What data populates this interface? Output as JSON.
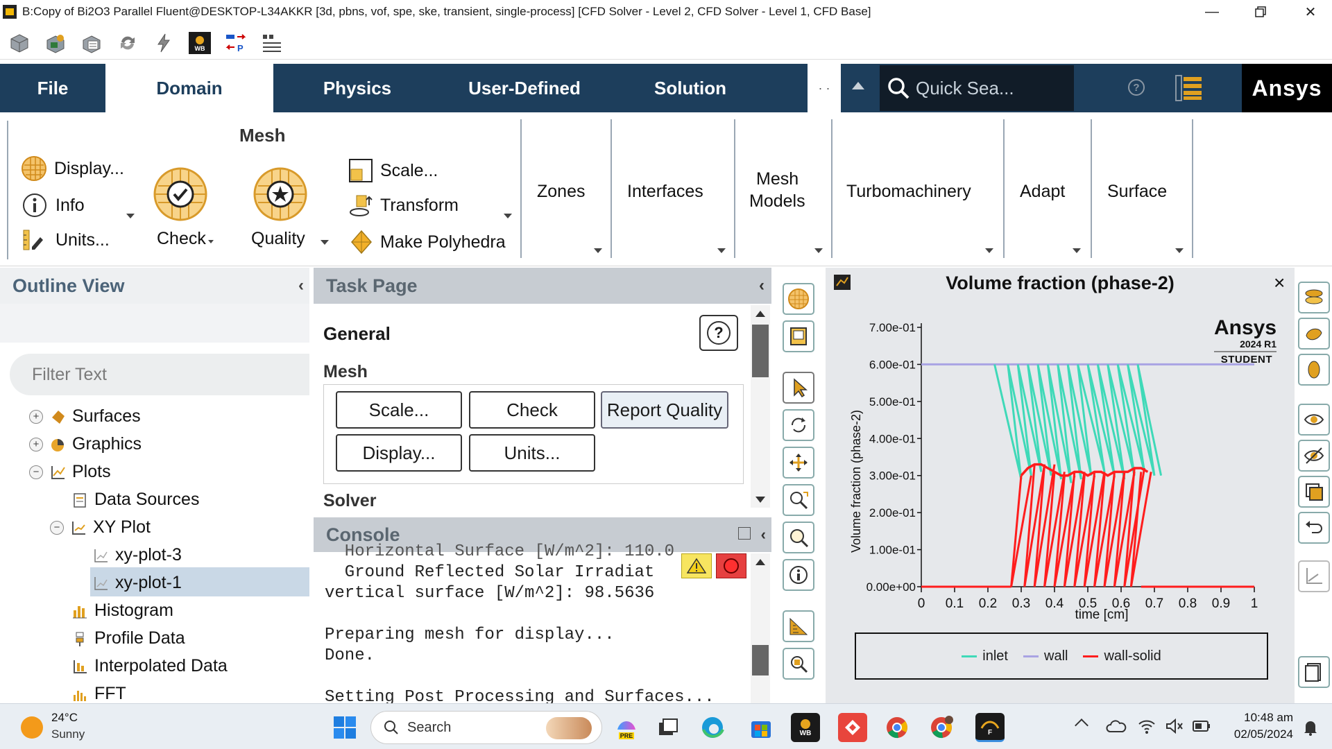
{
  "window": {
    "title": "B:Copy of Bi2O3 Parallel Fluent@DESKTOP-L34AKKR  [3d, pbns, vof, spe, ske, transient, single-process] [CFD Solver - Level 2, CFD Solver - Level 1, CFD Base]",
    "controls": [
      "minimize-icon",
      "restore-icon",
      "close-icon"
    ]
  },
  "quick_toolbar": {
    "icons": [
      "open-case-icon",
      "save-case-icon",
      "data-file-icon",
      "refresh-icon",
      "lightning-icon",
      "workbench-icon",
      "parameters-icon",
      "menu-list-icon"
    ],
    "wb_label": "WB",
    "p_label": "P"
  },
  "tabs": {
    "file": "File",
    "domain": "Domain",
    "physics": "Physics",
    "user_defined": "User-Defined",
    "solution": "Solution",
    "overflow": "· ·",
    "search_placeholder": "Quick Sea...",
    "help": "?",
    "brand": "Ansys"
  },
  "ribbon": {
    "mesh_group": "Mesh",
    "display": "Display...",
    "info": "Info",
    "units": "Units...",
    "check": "Check",
    "quality": "Quality",
    "scale": "Scale...",
    "transform": "Transform",
    "make_polyhedra": "Make Polyhedra",
    "zones": "Zones",
    "interfaces": "Interfaces",
    "mesh_models_line1": "Mesh",
    "mesh_models_line2": "Models",
    "turbomachinery": "Turbomachinery",
    "adapt": "Adapt",
    "surface": "Surface"
  },
  "outline": {
    "title": "Outline View",
    "collapse": "‹",
    "filter_placeholder": "Filter Text",
    "items": [
      {
        "label": "Surfaces",
        "expander": "+"
      },
      {
        "label": "Graphics",
        "expander": "+"
      },
      {
        "label": "Plots",
        "expander": "−"
      },
      {
        "label": "Data Sources"
      },
      {
        "label": "XY Plot",
        "expander": "−"
      },
      {
        "label": "xy-plot-3"
      },
      {
        "label": "xy-plot-1",
        "selected": true
      },
      {
        "label": "Histogram"
      },
      {
        "label": "Profile Data"
      },
      {
        "label": "Interpolated Data"
      },
      {
        "label": "FFT"
      }
    ]
  },
  "task_page": {
    "title": "Task Page",
    "collapse": "‹",
    "section": "General",
    "help": "?",
    "mesh_label": "Mesh",
    "buttons": {
      "scale": "Scale...",
      "check": "Check",
      "report_quality": "Report Quality",
      "display": "Display...",
      "units": "Units..."
    },
    "solver_label": "Solver"
  },
  "console": {
    "title": "Console",
    "lines": [
      "  Horizontal Surface [W/m^2]: 110.0",
      "  Ground Reflected Solar Irradiat",
      "vertical surface [W/m^2]: 98.5636",
      "",
      "Preparing mesh for display...",
      "Done.",
      "",
      "Setting Post Processing and Surfaces..."
    ]
  },
  "graphics": {
    "title": "Volume fraction (phase-2)",
    "close": "×",
    "watermark": {
      "brand": "Ansys",
      "version": "2024 R1",
      "edition": "STUDENT"
    },
    "colors": {
      "inlet": "#3fd9b8",
      "wall": "#a9a3e3",
      "wall-solid": "#ff1d1d"
    }
  },
  "chart_data": {
    "type": "line",
    "title": "Volume fraction (phase-2)",
    "xlabel": "time [cm]",
    "ylabel": "Volume fraction (phase-2)",
    "xlim": [
      0,
      1
    ],
    "ylim": [
      0,
      0.7
    ],
    "x_ticks": [
      "0",
      "0.1",
      "0.2",
      "0.3",
      "0.4",
      "0.5",
      "0.6",
      "0.7",
      "0.8",
      "0.9",
      "1"
    ],
    "y_ticks": [
      "0.00e+00",
      "1.00e-01",
      "2.00e-01",
      "3.00e-01",
      "4.00e-01",
      "5.00e-01",
      "6.00e-01",
      "7.00e-01"
    ],
    "legend_position": "bottom",
    "series": [
      {
        "name": "inlet",
        "color": "#3fd9b8",
        "x": [
          0.22,
          0.3,
          0.26,
          0.33,
          0.29,
          0.36,
          0.32,
          0.39,
          0.35,
          0.42,
          0.38,
          0.45,
          0.41,
          0.48,
          0.44,
          0.51,
          0.47,
          0.55,
          0.5,
          0.58,
          0.53,
          0.61,
          0.56,
          0.64,
          0.59,
          0.67,
          0.62,
          0.7,
          0.65,
          0.72
        ],
        "y": [
          0.6,
          0.29,
          0.6,
          0.3,
          0.6,
          0.31,
          0.6,
          0.3,
          0.6,
          0.29,
          0.6,
          0.28,
          0.6,
          0.29,
          0.6,
          0.3,
          0.6,
          0.31,
          0.6,
          0.3,
          0.6,
          0.29,
          0.6,
          0.3,
          0.6,
          0.31,
          0.6,
          0.3,
          0.6,
          0.3
        ]
      },
      {
        "name": "wall",
        "color": "#a9a3e3",
        "x": [
          0,
          1
        ],
        "y": [
          0.6,
          0.6
        ]
      },
      {
        "name": "wall-solid",
        "color": "#ff1d1d",
        "x": [
          0.3,
          0.32,
          0.34,
          0.36,
          0.38,
          0.4,
          0.42,
          0.44,
          0.46,
          0.48,
          0.5,
          0.52,
          0.54,
          0.56,
          0.58,
          0.6,
          0.62,
          0.64,
          0.66,
          0.68
        ],
        "y": [
          0.3,
          0.32,
          0.33,
          0.33,
          0.32,
          0.31,
          0.3,
          0.3,
          0.31,
          0.31,
          0.3,
          0.31,
          0.31,
          0.3,
          0.31,
          0.31,
          0.31,
          0.32,
          0.32,
          0.31
        ],
        "dropouts": [
          0.3,
          0.34,
          0.37,
          0.4,
          0.43,
          0.46,
          0.49,
          0.52,
          0.55,
          0.58,
          0.61,
          0.64,
          0.66
        ]
      }
    ]
  },
  "taskbar": {
    "weather_temp": "24°C",
    "weather_desc": "Sunny",
    "search_label": "Search",
    "time": "10:48 am",
    "date": "02/05/2024",
    "pre_label": "PRE",
    "wb_label": "WB",
    "f_label": "F"
  }
}
